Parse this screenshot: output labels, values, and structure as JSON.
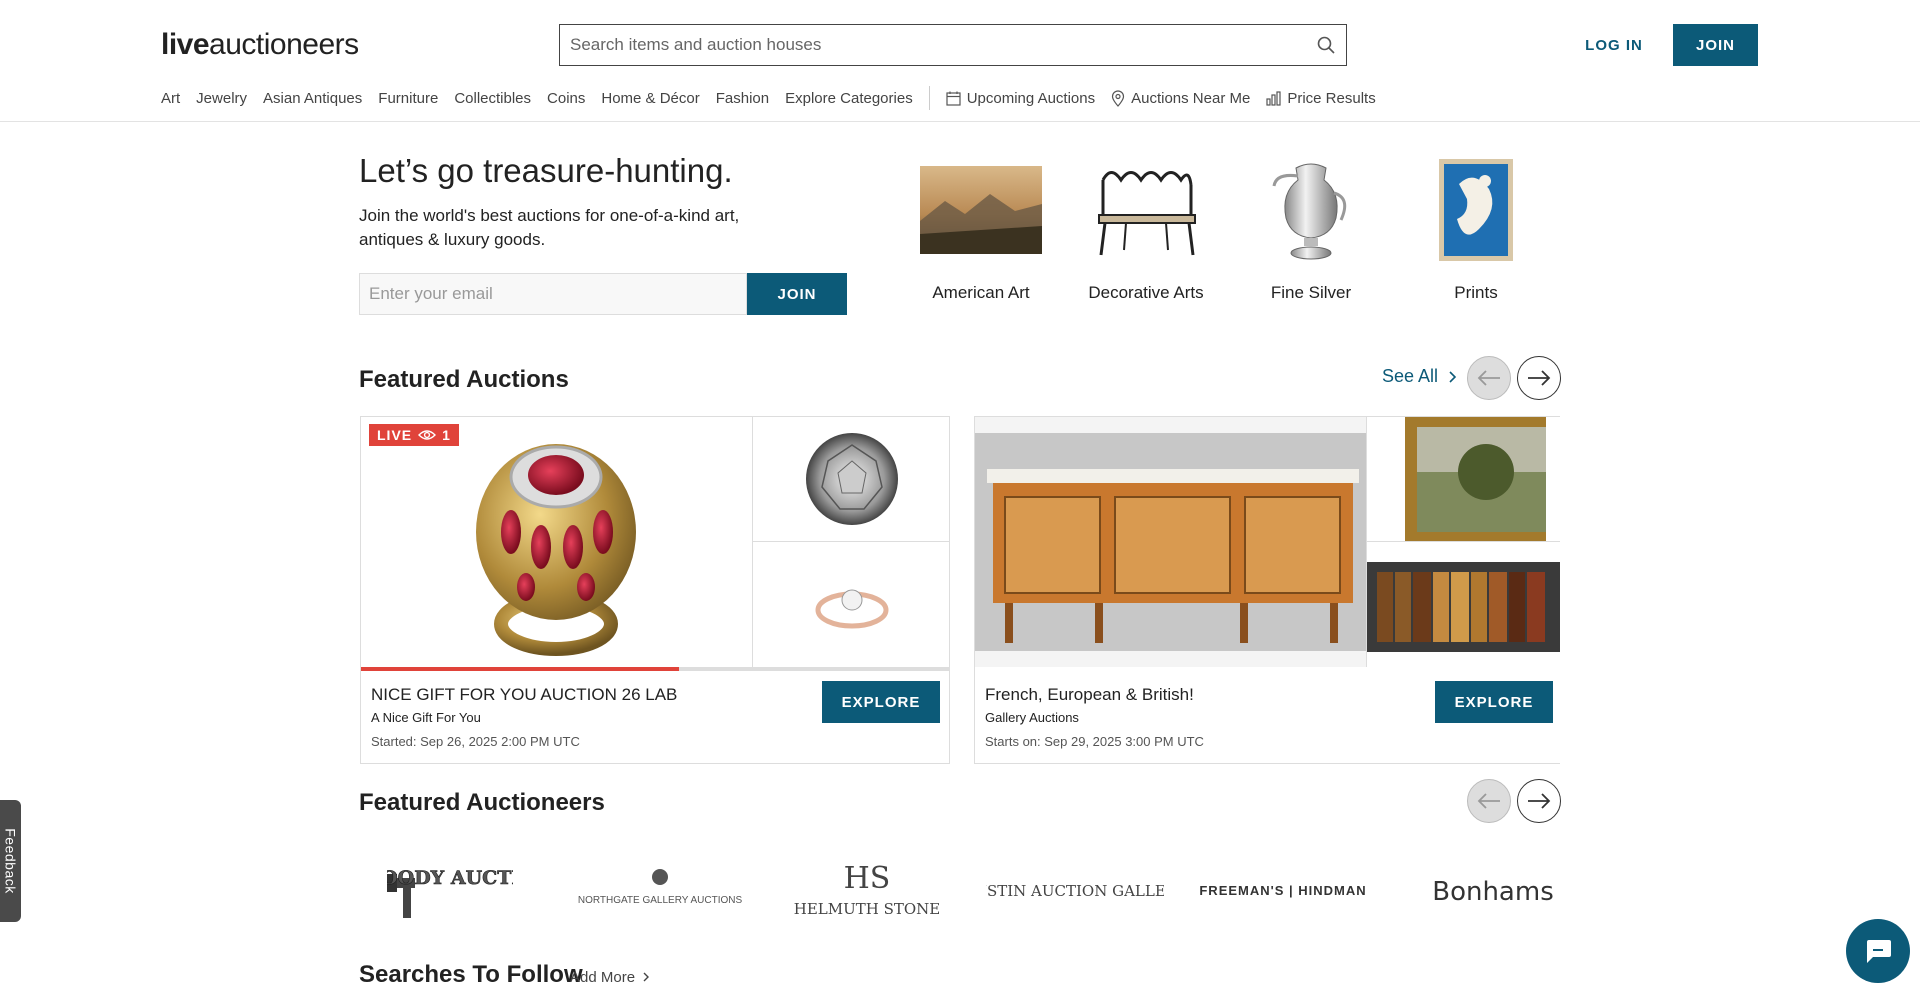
{
  "header": {
    "logo_live": "live",
    "logo_rest": "auctioneers",
    "search_placeholder": "Search items and auction houses",
    "login_label": "LOG IN",
    "join_label": "JOIN"
  },
  "nav": {
    "categories": [
      "Art",
      "Jewelry",
      "Asian Antiques",
      "Furniture",
      "Collectibles",
      "Coins",
      "Home & Décor",
      "Fashion",
      "Explore Categories"
    ],
    "upcoming": "Upcoming Auctions",
    "near_me": "Auctions Near Me",
    "price_results": "Price Results"
  },
  "hero": {
    "title": "Let’s go treasure-hunting.",
    "subtitle": "Join the world's best auctions for one-of-a-kind art, antiques & luxury goods.",
    "email_placeholder": "Enter your email",
    "join_label": "JOIN",
    "categories": [
      "American Art",
      "Decorative Arts",
      "Fine Silver",
      "Prints"
    ]
  },
  "featured_auctions": {
    "title": "Featured Auctions",
    "see_all": "See All",
    "cards": [
      {
        "badge": "LIVE",
        "viewers": "1",
        "progress_pct": 54,
        "title": "NICE GIFT FOR YOU AUCTION 26 LAB",
        "house": "A Nice Gift For You",
        "time": "Started: Sep 26, 2025 2:00 PM UTC",
        "button": "EXPLORE"
      },
      {
        "title": "French, European & British!",
        "house": "Gallery Auctions",
        "time": "Starts on: Sep 29, 2025 3:00 PM UTC",
        "button": "EXPLORE"
      }
    ]
  },
  "featured_auctioneers": {
    "title": "Featured Auctioneers",
    "logos": [
      "WOODY AUCTION",
      "NORTHGATE GALLERY AUCTIONS",
      "HELMUTH STONE",
      "AUSTIN AUCTION GALLERY",
      "FREEMAN'S | HINDMAN",
      "Bonhams"
    ]
  },
  "searches": {
    "title": "Searches To Follow",
    "add_more": "Add More"
  },
  "feedback_label": "Feedback",
  "colors": {
    "brand": "#0c5a78",
    "live": "#e0433a"
  }
}
